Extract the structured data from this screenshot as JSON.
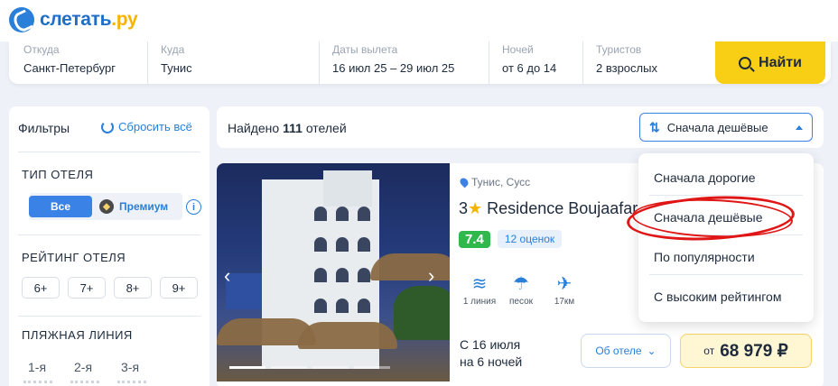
{
  "brand": {
    "name": "слетать",
    "suffix": ".ру"
  },
  "search": {
    "from": {
      "label": "Откуда",
      "value": "Санкт-Петербург"
    },
    "to": {
      "label": "Куда",
      "value": "Тунис"
    },
    "dates": {
      "label": "Даты вылета",
      "value": "16 июл 25 – 29 июл 25"
    },
    "nights": {
      "label": "Ночей",
      "value": "от 6 до 14"
    },
    "tourists": {
      "label": "Туристов",
      "value": "2 взрослых"
    },
    "find_label": "Найти"
  },
  "filters": {
    "title": "Фильтры",
    "reset_label": "Сбросить всё",
    "hotel_type": {
      "title": "ТИП ОТЕЛЯ",
      "all": "Все",
      "premium": "Премиум",
      "info": "i"
    },
    "rating": {
      "title": "РЕЙТИНГ ОТЕЛЯ",
      "options": [
        "6+",
        "7+",
        "8+",
        "9+"
      ]
    },
    "beach": {
      "title": "ПЛЯЖНАЯ ЛИНИЯ",
      "options": [
        "1-я",
        "2-я",
        "3-я"
      ]
    }
  },
  "results": {
    "found_prefix": "Найдено",
    "found_count": "111",
    "found_suffix": "отелей",
    "sort_current": "Сначала дешёвые"
  },
  "sort_menu": {
    "options": [
      "Сначала дорогие",
      "Сначала дешёвые",
      "По популярности",
      "С высоким рейтингом"
    ],
    "highlighted_index": 1
  },
  "hotel": {
    "location": "Тунис, Сусс",
    "stars": "3",
    "star_glyph": "★",
    "name": "Residence Boujaafar",
    "score": "7.4",
    "reviews": "12 оценок",
    "amenities": [
      {
        "icon": "beach-line-icon",
        "label": "1 линия"
      },
      {
        "icon": "sand-beach-icon",
        "label": "песок"
      },
      {
        "icon": "airport-distance-icon",
        "label": "17км"
      }
    ],
    "dates_line1": "С 16 июля",
    "dates_line2": "на 6 ночей",
    "about_label": "Об отеле",
    "price_from": "от",
    "price": "68 979 ₽",
    "photo_slides": 4,
    "photo_active_slide": 1
  },
  "colors": {
    "accent": "#3b82e6",
    "cta": "#f8cf14",
    "rating_good": "#2fb84c",
    "highlight_scribble": "#e01515"
  }
}
